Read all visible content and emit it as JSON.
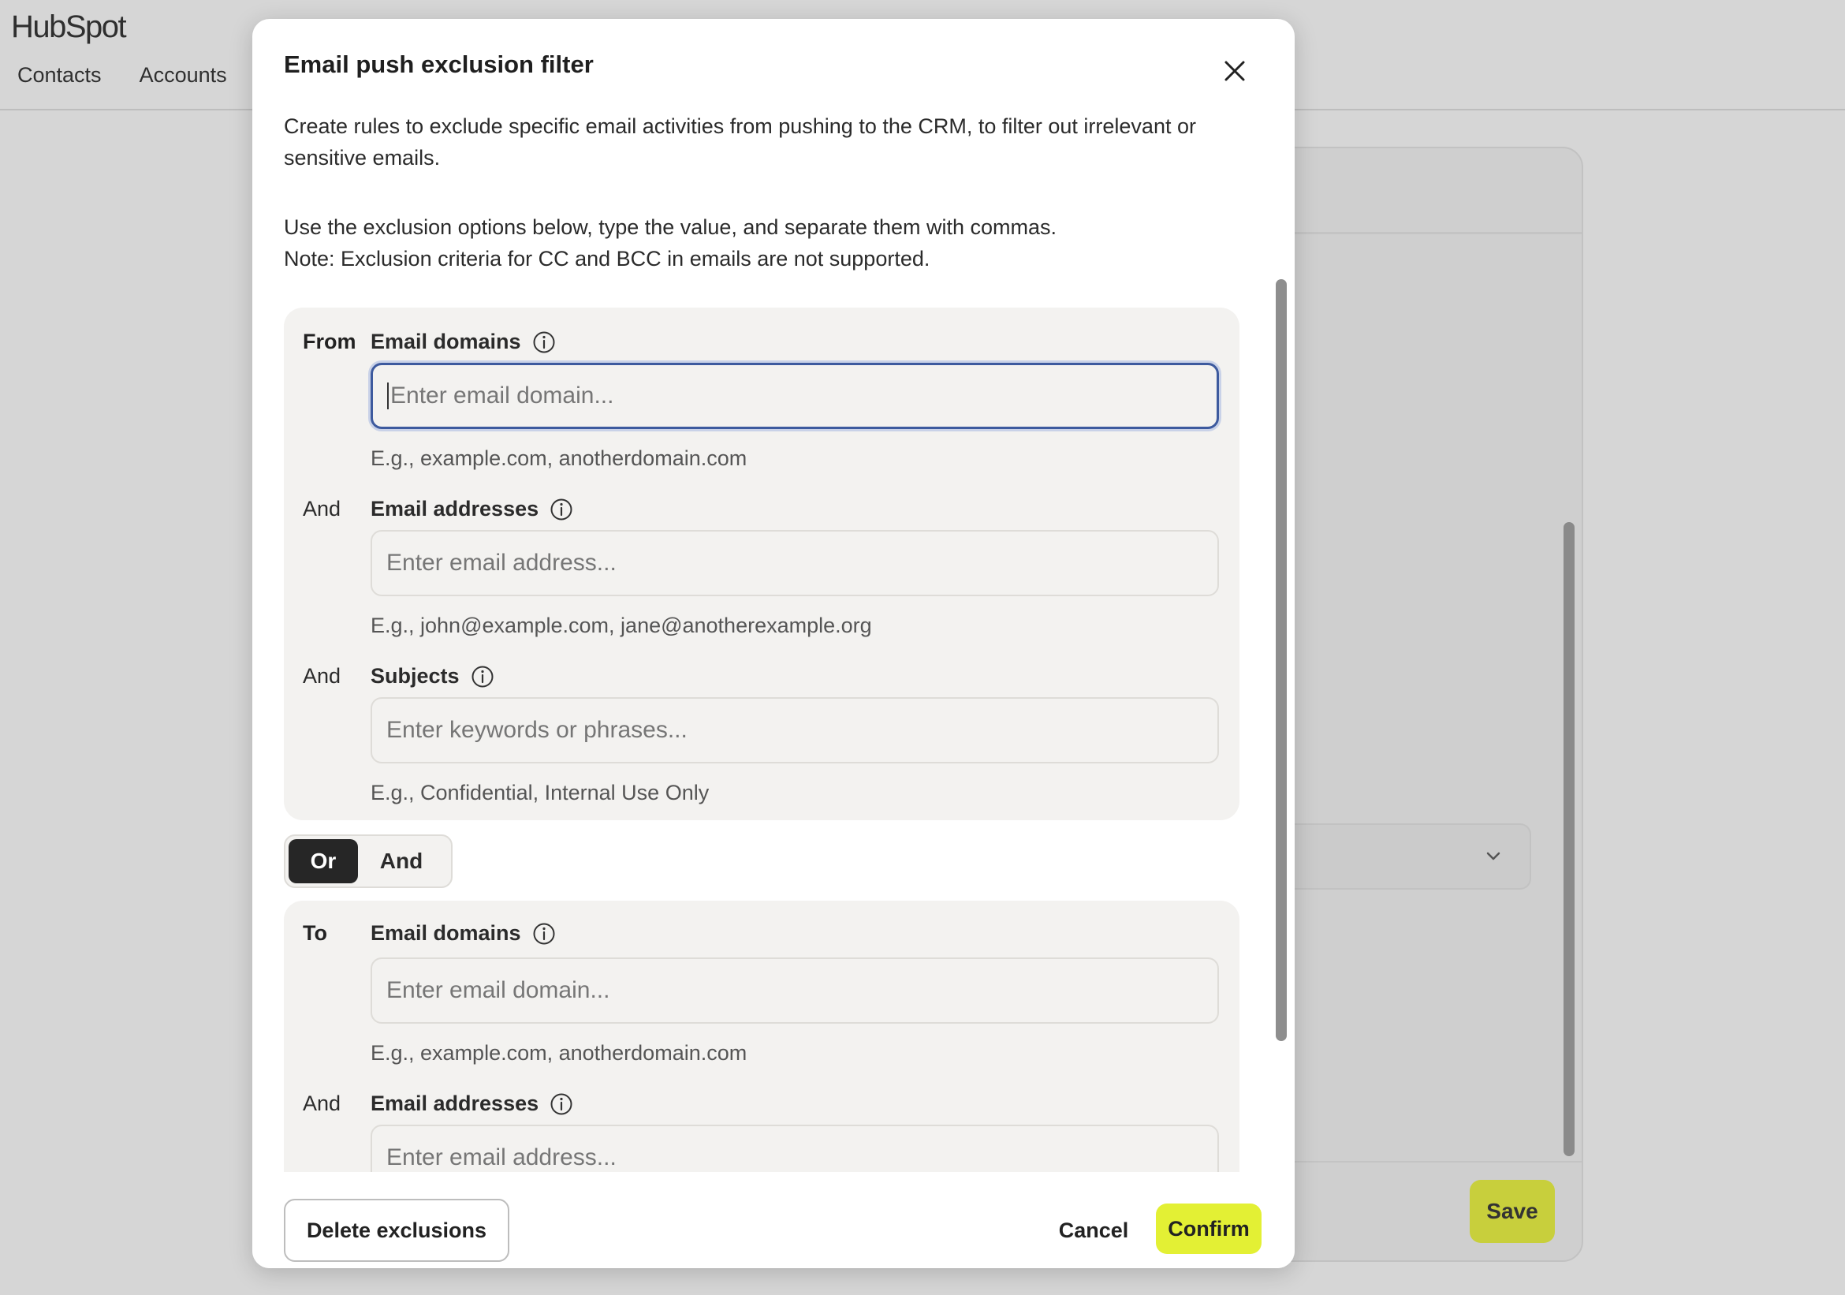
{
  "app": {
    "brand": "HubSpot",
    "nav": [
      "Contacts",
      "Accounts"
    ],
    "save_label": "Save"
  },
  "modal": {
    "title": "Email push exclusion filter",
    "description_1": "Create rules to exclude specific email activities from pushing to the CRM, to filter out irrelevant or sensitive emails.",
    "description_2": "Use the exclusion options below, type the value, and separate them with commas.",
    "description_3": "Note: Exclusion criteria for CC and BCC in emails are not supported.",
    "from_group": {
      "label": "From",
      "and_label": "And",
      "domains": {
        "label": "Email domains",
        "value": "",
        "placeholder": "Enter email domain...",
        "hint": "E.g., example.com, anotherdomain.com"
      },
      "addresses": {
        "label": "Email addresses",
        "value": "",
        "placeholder": "Enter email address...",
        "hint": "E.g., john@example.com, jane@anotherexample.org"
      },
      "subjects": {
        "label": "Subjects",
        "value": "",
        "placeholder": "Enter keywords or phrases...",
        "hint": "E.g., Confidential, Internal Use Only"
      }
    },
    "toggle": {
      "options": [
        "Or",
        "And"
      ],
      "selected": "Or"
    },
    "to_group": {
      "label": "To",
      "and_label": "And",
      "domains": {
        "label": "Email domains",
        "value": "",
        "placeholder": "Enter email domain...",
        "hint": "E.g., example.com, anotherdomain.com"
      },
      "addresses": {
        "label": "Email addresses",
        "value": "",
        "placeholder": "Enter email address..."
      }
    },
    "footer": {
      "delete_label": "Delete exclusions",
      "cancel_label": "Cancel",
      "confirm_label": "Confirm"
    }
  },
  "colors": {
    "accent_confirm": "#e3f034",
    "accent_save_dimmed": "#c8cf3c",
    "focus_ring": "#3d5a9e",
    "toggle_active": "#262626"
  }
}
